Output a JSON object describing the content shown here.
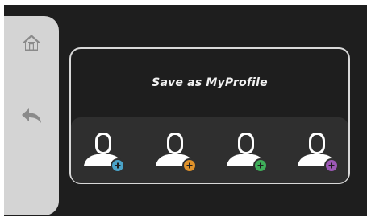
{
  "panel": {
    "title": "Save as MyProfile"
  },
  "sidebar": {
    "items": [
      {
        "icon": "home-icon"
      },
      {
        "icon": "back-arrow-icon"
      }
    ]
  },
  "profiles": [
    {
      "icon": "user-add-icon",
      "badge_color": "#4aa3c8"
    },
    {
      "icon": "user-add-icon",
      "badge_color": "#e0922a"
    },
    {
      "icon": "user-add-icon",
      "badge_color": "#3fae5a"
    },
    {
      "icon": "user-add-icon",
      "badge_color": "#9c58b6"
    }
  ],
  "colors": {
    "background": "#1e1e1e",
    "sidebar": "#d4d4d4",
    "tray": "#2f2f2f",
    "border": "#d8d8d8"
  }
}
